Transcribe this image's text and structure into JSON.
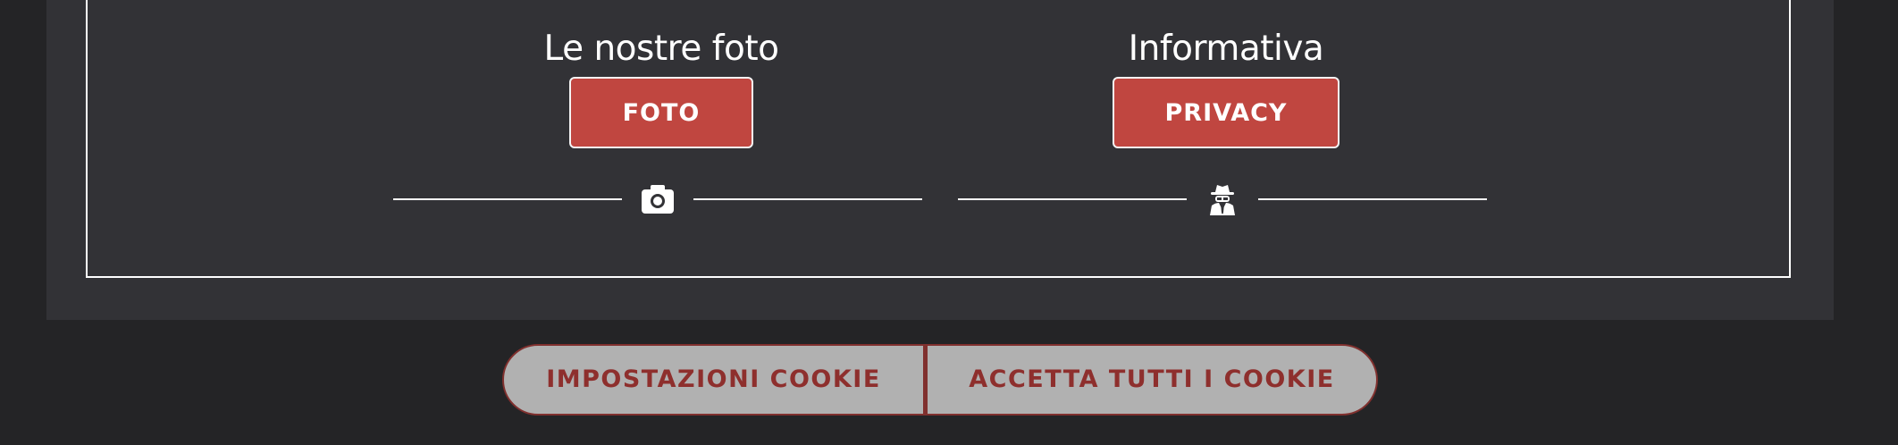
{
  "gallery": {
    "title": "Le nostre foto",
    "button_label": "FOTO",
    "icon": "camera-icon"
  },
  "info": {
    "title": "Informativa",
    "button_label": "PRIVACY",
    "icon": "incognito-spy-icon"
  },
  "cookie_banner": {
    "settings_label": "IMPOSTAZIONI COOKIE",
    "accept_all_label": "ACCETTA TUTTI I COOKIE"
  },
  "colors": {
    "page_background": "#242426",
    "panel_background": "#323236",
    "button_red": "#c04640",
    "cookie_button_background": "#b1b1b1",
    "cookie_text": "#8e2f2d"
  }
}
